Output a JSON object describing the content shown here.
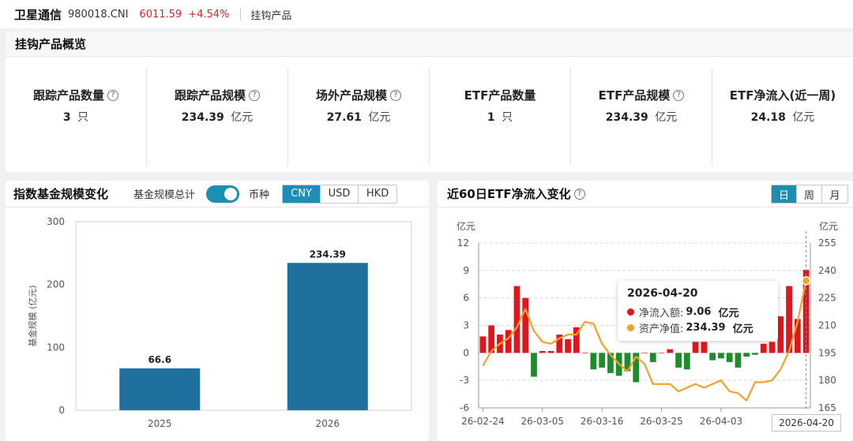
{
  "topbar": {
    "name": "卫星通信",
    "code": "980018.CNI",
    "price": "6011.59",
    "change": "+4.54%",
    "crumb": "挂钩产品"
  },
  "overview": {
    "title": "挂钩产品概览",
    "stats": [
      {
        "label": "跟踪产品数量",
        "value": "3",
        "unit": "只",
        "help": true
      },
      {
        "label": "跟踪产品规模",
        "value": "234.39",
        "unit": "亿元",
        "help": true
      },
      {
        "label": "场外产品规模",
        "value": "27.61",
        "unit": "亿元",
        "help": true
      },
      {
        "label": "ETF产品数量",
        "value": "1",
        "unit": "只",
        "help": false
      },
      {
        "label": "ETF产品规模",
        "value": "234.39",
        "unit": "亿元",
        "help": true
      },
      {
        "label": "ETF净流入(近一周)",
        "value": "24.18",
        "unit": "亿元",
        "help": false
      }
    ]
  },
  "left_panel": {
    "title": "指数基金规模变化",
    "toggle_label": "基金规模总计",
    "toggle_on": true,
    "currency_label": "币种",
    "currencies": [
      "CNY",
      "USD",
      "HKD"
    ],
    "selected_currency": "CNY"
  },
  "right_panel": {
    "title": "近60日ETF净流入变化",
    "periods": [
      "日",
      "周",
      "月"
    ],
    "selected_period": "日",
    "tooltip": {
      "date": "2026-04-20",
      "net_inflow_label": "净流入额:",
      "net_inflow_value": "9.06",
      "net_inflow_unit": "亿元",
      "nav_label": "资产净值:",
      "nav_value": "234.39",
      "nav_unit": "亿元"
    },
    "cursor_date": "2026-04-20"
  },
  "colors": {
    "accent": "#1a8fb3",
    "bar_left": "#1f6f9f",
    "up": "#e0161c",
    "down": "#1e8c2a",
    "line": "#f0a22a",
    "price_up": "#d6262a"
  },
  "chart_data": [
    {
      "type": "bar",
      "categories": [
        "2025",
        "2026"
      ],
      "values": [
        66.6,
        234.39
      ],
      "data_labels": [
        "66.6",
        "234.39"
      ],
      "ylabel": "基金规模 (亿元)",
      "ylim": [
        0,
        300
      ],
      "yticks": [
        "0",
        "100",
        "200",
        "300"
      ],
      "grid": false
    },
    {
      "type": "bar",
      "combo": "bar+line",
      "left_unit": "亿元",
      "right_unit": "亿元",
      "left_yticks": [
        "-6",
        "-3",
        "0",
        "3",
        "6",
        "9",
        "12"
      ],
      "right_yticks": [
        "165",
        "180",
        "195",
        "210",
        "225",
        "240",
        "255"
      ],
      "ylim_left": [
        -6,
        12
      ],
      "ylim_right": [
        165,
        255
      ],
      "x_tick_labels": [
        "26-02-24",
        "26-03-05",
        "26-03-16",
        "26-03-25",
        "26-04-03"
      ],
      "x_tick_index": [
        0,
        7,
        14,
        21,
        28
      ],
      "series": [
        {
          "name": "净流入额",
          "axis": "left",
          "values": [
            1.8,
            3.0,
            2.0,
            2.5,
            7.3,
            6.0,
            -2.6,
            0.2,
            0.2,
            2.0,
            1.5,
            2.8,
            0.0,
            -1.8,
            -1.6,
            -2.2,
            -2.5,
            -2.0,
            -3.2,
            0.0,
            -1.0,
            0.0,
            0.4,
            -1.6,
            -1.8,
            1.2,
            1.2,
            -0.8,
            -0.6,
            -1.0,
            -1.6,
            -0.4,
            -0.2,
            1.0,
            1.2,
            4.0,
            7.3,
            3.7,
            9.06
          ]
        },
        {
          "name": "资产净值",
          "axis": "right",
          "values": [
            188,
            196,
            200,
            203,
            209,
            219,
            207,
            201,
            200,
            203,
            205,
            205,
            212,
            211,
            200,
            194,
            189,
            185,
            193,
            189,
            178,
            178,
            178,
            174,
            176,
            178,
            176,
            178,
            180,
            174,
            173,
            169,
            179,
            179,
            180,
            186,
            196,
            212,
            234.39
          ]
        }
      ]
    }
  ]
}
